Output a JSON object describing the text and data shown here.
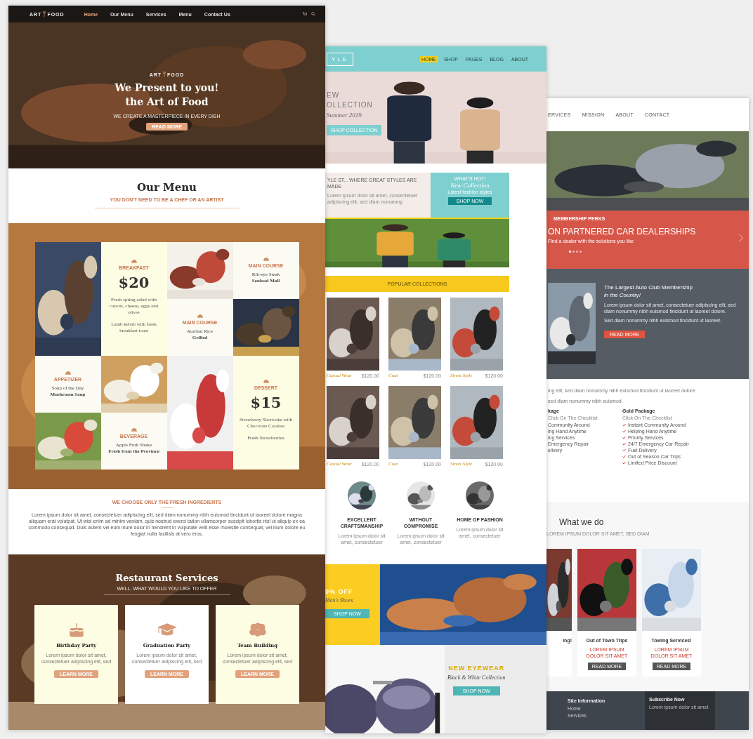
{
  "art_food": {
    "nav": {
      "logo": "ART",
      "logo_2": "FOOD",
      "items": [
        {
          "label": "Home",
          "selected": true
        },
        {
          "label": "Our Menu",
          "selected": false
        },
        {
          "label": "Services",
          "selected": false
        },
        {
          "label": "Menu",
          "selected": false
        },
        {
          "label": "Contact Us",
          "selected": false
        }
      ]
    },
    "hero": {
      "logo": "ART",
      "logo_2": "FOOD",
      "title": [
        "We Present to you!",
        "the Art of Food"
      ],
      "subtitle": "WE CREATE A MASTERPIECE IN EVERY DISH",
      "button": "READ MORE"
    },
    "menu_heading": {
      "title": "Our Menu",
      "subtitle": "YOU DON'T NEED TO BE A CHEF OR AN ARTIST"
    },
    "menu_grid": [
      {
        "kind": "picture"
      },
      {
        "kind": "price",
        "category": "BREAKFAST",
        "price": "$20",
        "description": "Fresh spring salad with carrots, cheese, eggs and olives",
        "note": "Lamb kebab with fresh breakfast toast"
      },
      {
        "kind": "picture"
      },
      {
        "kind": "card",
        "category": "MAIN COURSE",
        "lines": [
          "Rib-eye Steak",
          "Seafood Mall"
        ]
      },
      {
        "kind": "card",
        "category": "MAIN COURSE",
        "lines": [
          "Arabian Rice",
          "Grilled"
        ]
      },
      {
        "kind": "picture"
      },
      {
        "kind": "card",
        "category": "APPETIZER",
        "lines": [
          "Soup of the Day",
          "Mushroom Soup"
        ]
      },
      {
        "kind": "picture"
      },
      {
        "kind": "picture"
      },
      {
        "kind": "price",
        "category": "DESSERT",
        "price": "$15",
        "description": "Strawberry Shortcake with Chocolate Cookies",
        "note": "Fresh Strawberries"
      },
      {
        "kind": "picture"
      },
      {
        "kind": "card",
        "category": "BEVERAGE",
        "lines": [
          "Apple Fruit Shake",
          "Fresh from the Province"
        ]
      }
    ],
    "ingredients": {
      "title": "WE CHOOSE ONLY THE FRESH INGREDIENTS",
      "text": "Lorem ipsum dolor sit amet, consectetuer adipiscing elit, sed diam nonummy nibh euismod tincidunt ut laoreet dolore magna aliquam erat volutpat. Ut wisi enim ad minim veniam, quis nostrud exerci tation ullamcorper suscipit lobortis nisl ut aliquip ex ea commodo consequat. Duis autem vel eum iriure dolor in hendrerit in vulputate velit esse molestie consequat, vel illum dolore eu feugiat nulla facilisis at vero eros."
    },
    "services": {
      "title": "Restaurant Services",
      "subtitle": "WELL, WHAT WOULD YOU LIKE TO OFFER",
      "cards": [
        {
          "kind": "cake",
          "color": "#fdfde3",
          "title": "Birthday Party",
          "text": "Lorem ipsum dolor sit amet, consectetuer adipiscing elit, sed",
          "button": "LEARN MORE"
        },
        {
          "kind": "cap",
          "color": "#ffffff",
          "title": "Graduation Party",
          "text": "Lorem ipsum dolor sit amet, consectetuer adipiscing elit, sed",
          "button": "LEARN MORE"
        },
        {
          "kind": "team",
          "color": "#fdfde3",
          "title": "Team Building",
          "text": "Lorem ipsum dolor sit amet, consectetuer adipiscing elit, sed",
          "button": "LEARN MORE"
        }
      ]
    }
  },
  "style_shop": {
    "nav": {
      "logo": "YLE",
      "items": [
        {
          "label": "HOME",
          "selected": true
        },
        {
          "label": "SHOP",
          "selected": false
        },
        {
          "label": "PAGES",
          "selected": false
        },
        {
          "label": "BLOG",
          "selected": false
        },
        {
          "label": "ABOUT",
          "selected": false
        }
      ]
    },
    "hero": {
      "lines": [
        "EW",
        "OLLECTION"
      ],
      "script": "Summer 2019",
      "button": "SHOP COLLECTION"
    },
    "intro": {
      "title": "YLE ST... WHERE GREAT STYLES ARE MADE",
      "text": "Lorem ipsum dolor sit amet, consectetuer adipiscing elit, sed diam nonummy."
    },
    "hot": {
      "title": "WHAT'S HOT!",
      "script": "New Collection",
      "text": "Latest fashion styles",
      "button": "SHOP NOW"
    },
    "popular": "POPULAR COLLECTIONS",
    "products": [
      {
        "name": "Casual Wear",
        "price": "$120.00"
      },
      {
        "name": "Coat",
        "price": "$120.00"
      },
      {
        "name": "Street Style",
        "price": "$120.00"
      },
      {
        "name": "Casual Wear",
        "price": "$120.00"
      },
      {
        "name": "Coat",
        "price": "$120.00"
      },
      {
        "name": "Street Style",
        "price": "$120.00"
      }
    ],
    "features": [
      {
        "title": "EXCELLENT CRAFTSMANSHIP",
        "text": "Lorem ipsum dolor sit amet, consectetuer"
      },
      {
        "title": "WITHOUT COMPROMISE",
        "text": "Lorem ipsum dolor sit amet, consectetuer"
      },
      {
        "title": "HOME OF FASHION",
        "text": "Lorem ipsum dolor sit amet, consectetuer"
      }
    ],
    "promo": {
      "title": "0% OFF",
      "script": "Men's Shoes",
      "button": "SHOP NOW"
    },
    "eyewear": {
      "title": "NEW EYEWEAR",
      "script": "Black & White Collection",
      "button": "SHOP NOW"
    }
  },
  "auto_club": {
    "nav": [
      "ERVICES",
      "MISSION",
      "ABOUT",
      "CONTACT"
    ],
    "slider": {
      "eyebrow": "MEMBERSHIP PERKS",
      "title": "ON PARTNERED CAR DEALERSHIPS",
      "text": "Find a dealer with the solutions you like",
      "dots": [
        {
          "selected": true
        },
        {
          "selected": false
        },
        {
          "selected": false
        },
        {
          "selected": false
        }
      ]
    },
    "about": {
      "title": "The Largest Auto Club Membership",
      "subtitle": "in the Country!",
      "text": [
        "Lorem ipsum dolor sit amet, consectetuer adipiscing elit, sed diam nonummy nibh euismod tincidunt ut laoreet dolore.",
        "Sed diam nonummy nibh euismod tincidunt ut laoreet."
      ],
      "button": "READ MORE"
    },
    "packages": {
      "lines": [
        "ing elit, sed diam nonummy nibh euismod tincidunt ut laoreet dolore",
        "sed diam nonummy nibh euismod"
      ],
      "columns": [
        {
          "title": "kage",
          "subtitle": "Click On The Checklist",
          "checked": false,
          "items": [
            "Community Around",
            "ing Hand Anytime",
            "ing Services",
            "Emergency Repair",
            "elivery"
          ]
        },
        {
          "title": "Gold Package",
          "subtitle": "Click On The Checklist",
          "checked": true,
          "items": [
            "Instant Community Around",
            "Helping Hand Anytime",
            "Priority Services",
            "24/7 Emergency Car Repair",
            "Fuel Delivery",
            "Out of Season Car Trips",
            "Limited Price Discount"
          ]
        }
      ]
    },
    "services": {
      "title": "What we do",
      "subtitle": "LOREM IPSUM DOLOR SIT AMET, SED DIAM",
      "cards": [
        {
          "title": "ing!"
        },
        {
          "title": "Out of Town Trips",
          "text": "LOREM IPSUM DOLOR SIT AMET",
          "button": "READ MORE"
        },
        {
          "title": "Towing Services!",
          "text": "LOREM IPSUM DOLOR SIT AMET",
          "button": "READ MORE"
        }
      ]
    },
    "footer": {
      "left": "Site Information",
      "links": [
        "Home",
        "Services"
      ],
      "right": "Subscribe Now",
      "right_text": "Lorem ipsum dolor sit amet"
    }
  }
}
